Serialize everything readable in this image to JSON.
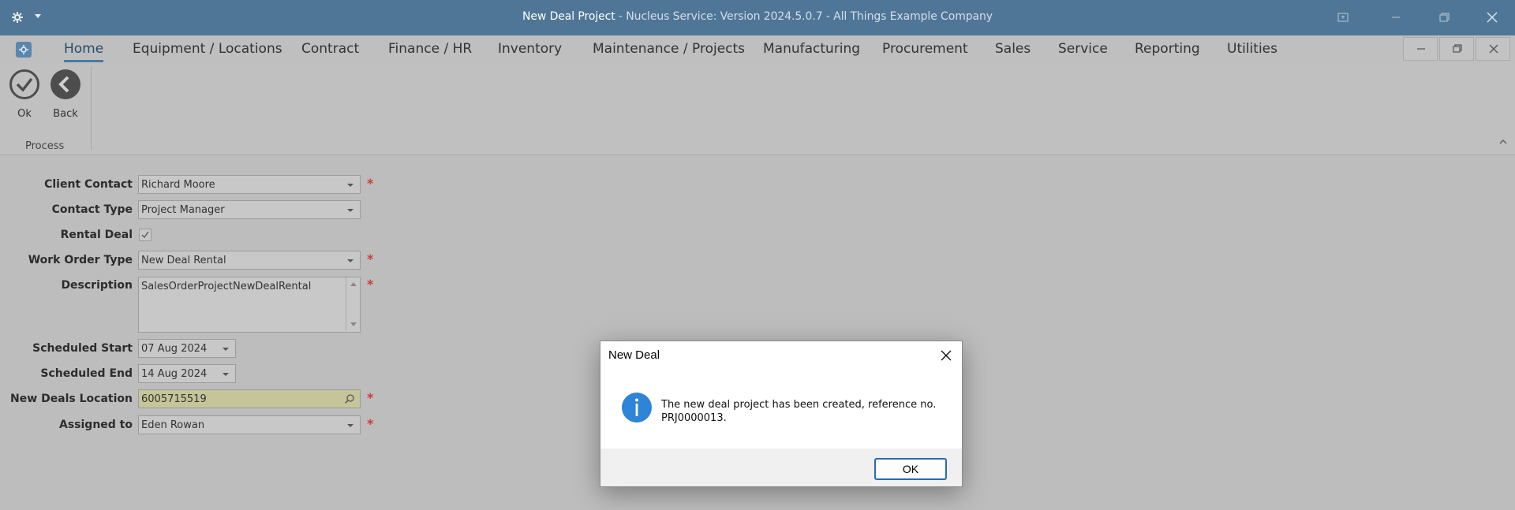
{
  "window": {
    "title_strong": "New Deal Project",
    "title_rest": " - Nucleus Service: Version 2024.5.0.7 - All Things Example Company"
  },
  "menu": {
    "items": [
      "Home",
      "Equipment / Locations",
      "Contract",
      "Finance / HR",
      "Inventory",
      "Maintenance / Projects",
      "Manufacturing",
      "Procurement",
      "Sales",
      "Service",
      "Reporting",
      "Utilities"
    ],
    "active": "Home"
  },
  "ribbon": {
    "ok_label": "Ok",
    "back_label": "Back",
    "group_label": "Process"
  },
  "form": {
    "client_contact": {
      "label": "Client Contact",
      "value": "Richard Moore"
    },
    "contact_type": {
      "label": "Contact Type",
      "value": "Project Manager"
    },
    "rental_deal": {
      "label": "Rental Deal",
      "checked": true
    },
    "work_order_type": {
      "label": "Work Order Type",
      "value": "New Deal Rental"
    },
    "description": {
      "label": "Description",
      "value": "SalesOrderProjectNewDealRental"
    },
    "scheduled_start": {
      "label": "Scheduled Start",
      "value": "07 Aug 2024"
    },
    "scheduled_end": {
      "label": "Scheduled End",
      "value": "14 Aug 2024"
    },
    "new_deals_location": {
      "label": "New Deals Location",
      "value": "6005715519"
    },
    "assigned_to": {
      "label": "Assigned to",
      "value": "Eden Rowan"
    },
    "required_mark": "*"
  },
  "dialog": {
    "title": "New Deal",
    "message": "The new deal project has been created, reference no. PRJ0000013.",
    "ok_label": "OK"
  },
  "colors": {
    "titlebar": "#4f7696",
    "accent": "#4a7aa3",
    "required": "#d23a3a",
    "info": "#2e84d6"
  }
}
